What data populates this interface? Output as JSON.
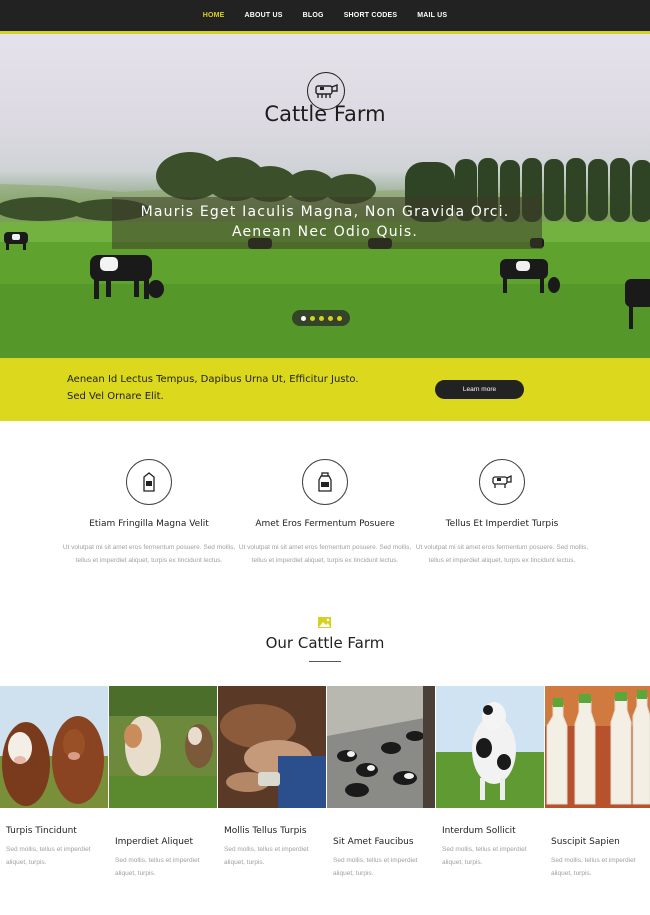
{
  "nav": {
    "items": [
      {
        "label": "HOME",
        "active": true
      },
      {
        "label": "ABOUT US"
      },
      {
        "label": "BLOG"
      },
      {
        "label": "SHORT CODES"
      },
      {
        "label": "MAIL US"
      }
    ],
    "accent_color": "#d6d01e"
  },
  "hero": {
    "logo_icon": "cow-icon",
    "title": "Cattle Farm",
    "caption_line1": "Mauris Eget Iaculis Magna, Non Gravida Orci.",
    "caption_line2": "Aenean Nec Odio Quis.",
    "slides": 5,
    "active_slide": 1
  },
  "banner": {
    "line1": "Aenean Id Lectus Tempus, Dapibus Urna Ut, Efficitur Justo.",
    "line2": "Sed Vel Ornare Elit.",
    "button_label": "Learn more",
    "background": "#dcd81e"
  },
  "features": [
    {
      "icon": "milk-carton-icon",
      "title": "Etiam Fringilla Magna Velit",
      "text": "Ut volutpat mi sit amet eros fermentum posuere. Sed mollis, tellus et imperdiet aliquet, turpis ex tincidunt lectus."
    },
    {
      "icon": "milk-can-icon",
      "title": "Amet Eros Fermentum Posuere",
      "text": "Ut volutpat mi sit amet eros fermentum posuere. Sed mollis, tellus et imperdiet aliquet, turpis ex tincidunt lectus."
    },
    {
      "icon": "cow-icon",
      "title": "Tellus Et Imperdiet Turpis",
      "text": "Ut volutpat mi sit amet eros fermentum posuere. Sed mollis, tellus et imperdiet aliquet, turpis ex tincidunt lectus."
    }
  ],
  "section": {
    "icon": "image-icon",
    "title": "Our Cattle Farm"
  },
  "gallery": [
    {
      "title": "Turpis Tincidunt",
      "text": "Sed mollis, tellus et imperdiet aliquet, turpis."
    },
    {
      "title": "Imperdiet Aliquet",
      "text": "Sed mollis, tellus et imperdiet aliquet, turpis."
    },
    {
      "title": "Mollis Tellus Turpis",
      "text": "Sed mollis, tellus et imperdiet aliquet, turpis."
    },
    {
      "title": "Sit Amet Faucibus",
      "text": "Sed mollis, tellus et imperdiet aliquet, turpis."
    },
    {
      "title": "Interdum Sollicit",
      "text": "Sed mollis, tellus et imperdiet aliquet, turpis."
    },
    {
      "title": "Suscipit Sapien",
      "text": "Sed mollis, tellus et imperdiet aliquet, turpis."
    }
  ]
}
